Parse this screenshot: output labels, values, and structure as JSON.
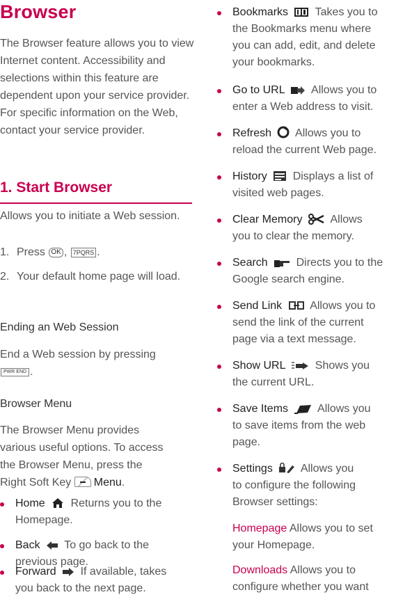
{
  "title": "Browser",
  "intro": "The Browser feature allows you to view Internet content. Accessibility and selections within this feature are dependent upon your service provider. For specific information on the Web, contact your service provider.",
  "section1": {
    "heading": "1. Start Browser",
    "desc": "Allows you to initiate a Web session.",
    "steps": [
      {
        "num": "1.",
        "pre": "Press",
        "key1": "OK",
        "sep": ",",
        "key2": "7PQRS",
        "post": "."
      },
      {
        "num": "2.",
        "text": "Your default home page will load."
      }
    ]
  },
  "ending": {
    "heading": "Ending an Web Session",
    "text": "End a Web session by pressing",
    "key": "PWR END",
    "post": "."
  },
  "menu": {
    "heading": "Browser Menu",
    "text_lines": [
      "The Browser Menu provides",
      "various useful options. To access",
      "the Browser Menu, press the"
    ],
    "last_pre": "Right Soft Key",
    "last_term": "Menu",
    "last_post": "."
  },
  "left_bullets": [
    {
      "term": "Home",
      "icon": "home-icon",
      "lines": [
        "Returns you to the",
        "Homepage."
      ]
    },
    {
      "term": "Back",
      "icon": "back-arrow-icon",
      "lines": [
        "To go back to the",
        "previous page."
      ]
    },
    {
      "term": "Forward",
      "icon": "forward-arrow-icon",
      "lines": [
        "If available, takes",
        "you back to the next page."
      ]
    }
  ],
  "right_bullets": [
    {
      "term": "Bookmarks",
      "icon": "bookmarks-icon",
      "lines": [
        "Takes you to",
        "the Bookmarks menu where",
        "you can add, edit, and delete",
        "your bookmarks."
      ]
    },
    {
      "term": "Go to URL",
      "icon": "go-to-url-icon",
      "lines": [
        "Allows you to",
        "enter a Web address to visit."
      ]
    },
    {
      "term": "Refresh",
      "icon": "refresh-icon",
      "lines": [
        "Allows you to",
        "reload the current Web page."
      ]
    },
    {
      "term": "History",
      "icon": "history-icon",
      "lines": [
        "Displays a list of",
        "visited web pages."
      ]
    },
    {
      "term": "Clear Memory",
      "icon": "clear-memory-icon",
      "lines": [
        "Allows",
        "you to clear the memory."
      ]
    },
    {
      "term": "Search",
      "icon": "search-icon",
      "lines": [
        "Directs you to the",
        "Google search engine."
      ]
    },
    {
      "term": "Send Link",
      "icon": "send-link-icon",
      "lines": [
        "Allows you to",
        "send the link of the current",
        "page via a text message."
      ]
    },
    {
      "term": "Show URL",
      "icon": "show-url-icon",
      "lines": [
        "Shows you",
        "the current URL."
      ]
    },
    {
      "term": "Save Items",
      "icon": "save-items-icon",
      "lines": [
        "Allows you",
        "to save items from the web",
        "page."
      ]
    },
    {
      "term": "Settings",
      "icon": "settings-icon",
      "lines": [
        "Allows you",
        "to configure the following",
        "Browser settings:"
      ]
    }
  ],
  "settings": [
    {
      "label": "Homepage",
      "lines": [
        "Allows you to set",
        "your Homepage."
      ]
    },
    {
      "label": "Downloads",
      "lines": [
        "Allows you to",
        "configure whether you want"
      ]
    }
  ],
  "colors": {
    "accent": "#c8004f",
    "text": "#555555"
  }
}
